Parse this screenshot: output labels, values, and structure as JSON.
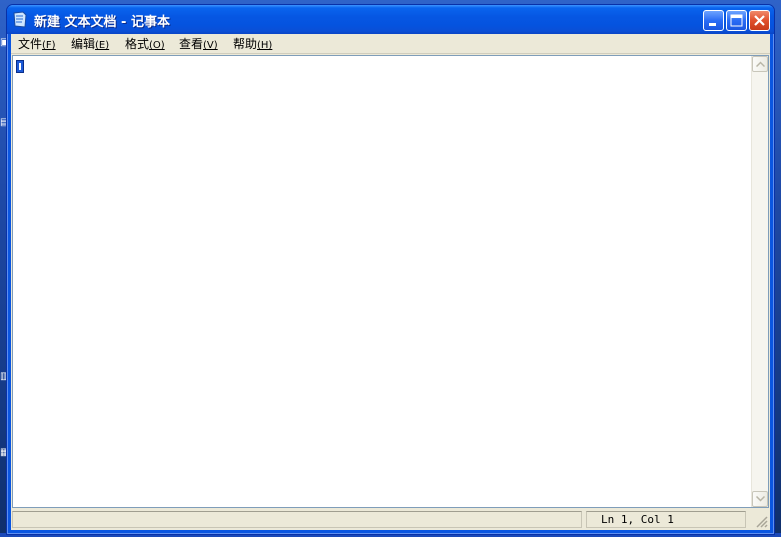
{
  "window": {
    "title": "新建 文本文档 - 记事本"
  },
  "menu": {
    "items": [
      {
        "label": "文件",
        "accel": "(F)"
      },
      {
        "label": "编辑",
        "accel": "(E)"
      },
      {
        "label": "格式",
        "accel": "(O)"
      },
      {
        "label": "查看",
        "accel": "(V)"
      },
      {
        "label": "帮助",
        "accel": "(H)"
      }
    ]
  },
  "editor": {
    "content": ""
  },
  "statusbar": {
    "position": "Ln 1, Col 1"
  },
  "colors": {
    "titlebar": "#0553df",
    "close_button": "#e0502d",
    "menu_background": "#ece9d8",
    "caret": "#1c5ad8"
  }
}
